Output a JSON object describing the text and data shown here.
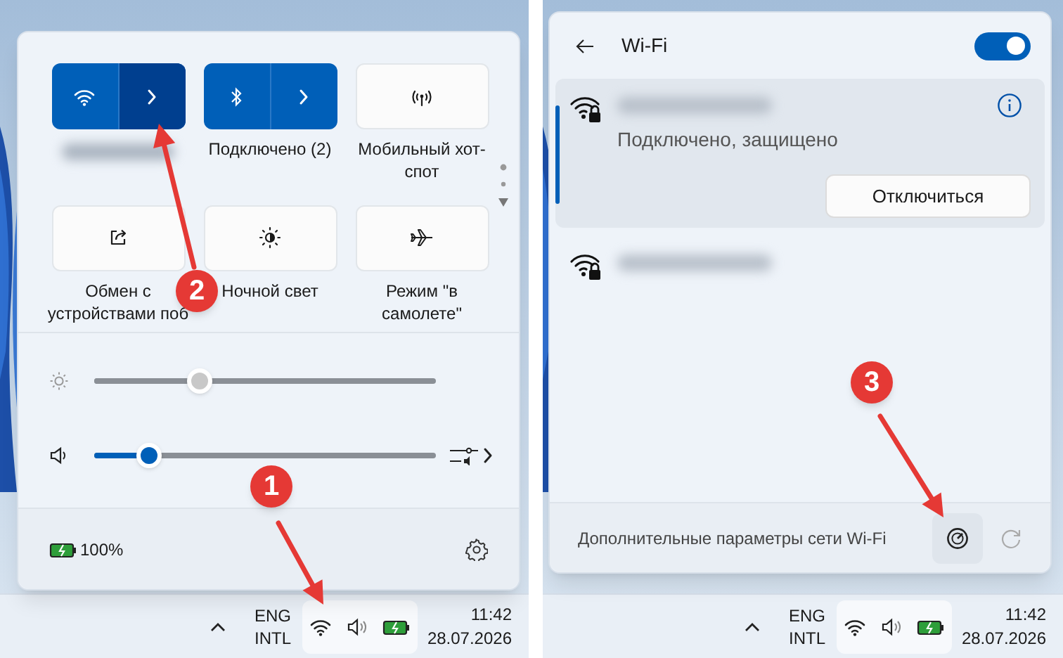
{
  "quick_settings": {
    "tiles": [
      {
        "kind": "wifi",
        "on": true,
        "expand_hovered": true
      },
      {
        "kind": "bluetooth",
        "on": true,
        "expand_hovered": false,
        "label": "Подключено (2)"
      },
      {
        "kind": "hotspot",
        "on": false,
        "label": "Мобильный хот-спот"
      },
      {
        "kind": "share",
        "on": false,
        "label": "Обмен с устройствами поб"
      },
      {
        "kind": "night-light",
        "on": false,
        "label": "Ночной свет"
      },
      {
        "kind": "airplane",
        "on": false,
        "label": "Режим \"в самолете\""
      }
    ],
    "sliders": [
      {
        "kind": "brightness",
        "disabled": true,
        "level": 0.31
      },
      {
        "kind": "volume",
        "disabled": false,
        "level": 0.16
      }
    ],
    "battery": "100%",
    "annotation": "2"
  },
  "taskbar_left": {
    "language": [
      "ENG",
      "INTL"
    ],
    "time": "11:42",
    "date": "28.07.2026",
    "annotation": "1"
  },
  "wifi_panel": {
    "title": "Wi-Fi",
    "on": true,
    "networks": [
      {
        "selected": true,
        "status": "Подключено, защищено",
        "action": "Отключиться"
      },
      {
        "selected": false
      }
    ],
    "footer": "Дополнительные параметры сети Wi-Fi",
    "annotation": "3"
  },
  "taskbar_right": {
    "language": [
      "ENG",
      "INTL"
    ],
    "time": "11:42",
    "date": "28.07.2026"
  }
}
